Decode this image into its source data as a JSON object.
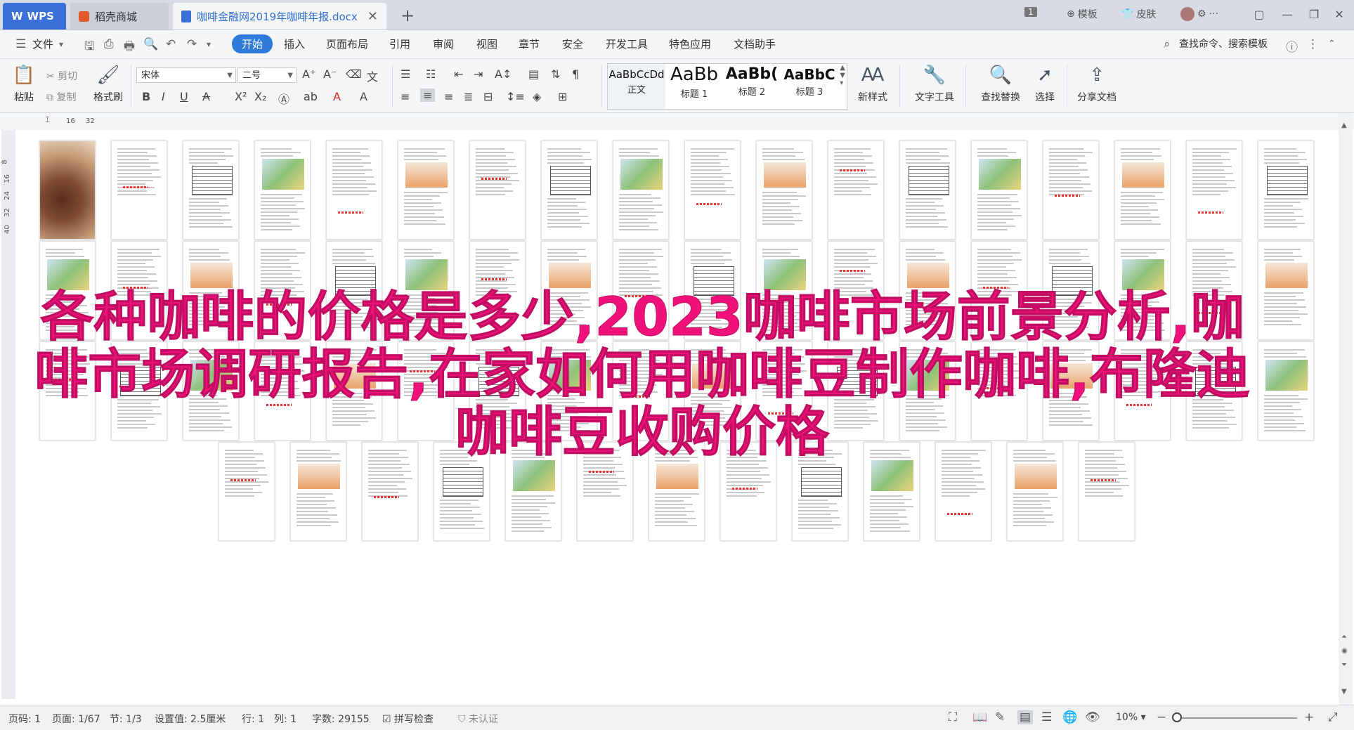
{
  "tabs": {
    "wps_label": "WPS",
    "store_label": "稻壳商城",
    "doc_label": "咖啡金融网2019年咖啡年报.docx",
    "new_tab": "+"
  },
  "titlebar_right": {
    "badge": "1",
    "template": "模板",
    "skin": "皮肤",
    "more": "···"
  },
  "menu": {
    "file": "文件",
    "items": [
      "开始",
      "插入",
      "页面布局",
      "引用",
      "审阅",
      "视图",
      "章节",
      "安全",
      "开发工具",
      "特色应用",
      "文档助手"
    ],
    "search_placeholder": "查找命令、搜索模板"
  },
  "ribbon": {
    "paste": "粘贴",
    "cut": "剪切",
    "copy": "复制",
    "format_painter": "格式刷",
    "font_name": "宋体",
    "font_size": "二号",
    "styles": [
      {
        "sample": "AaBbCcDd",
        "name": "正文"
      },
      {
        "sample": "AaBb",
        "name": "标题 1"
      },
      {
        "sample": "AaBb(",
        "name": "标题 2"
      },
      {
        "sample": "AaBbC",
        "name": "标题 3"
      }
    ],
    "new_style": "新样式",
    "text_tools": "文字工具",
    "find_replace": "查找替换",
    "select": "选择",
    "share_doc": "分享文档"
  },
  "ruler": {
    "h_marks": [
      "16",
      "32"
    ],
    "v_marks": [
      "8",
      "16",
      "24",
      "32",
      "40"
    ]
  },
  "overlay_title": "各种咖啡的价格是多少,2023咖啡市场前景分析,咖啡市场调研报告,在家如何用咖啡豆制作咖啡,布隆迪咖啡豆收购价格",
  "statusbar": {
    "page_num": "页码: 1",
    "page": "页面: 1/67",
    "section": "节: 1/3",
    "setting": "设置值: 2.5厘米",
    "row": "行: 1",
    "col": "列: 1",
    "word_count": "字数: 29155",
    "spell_check": "拼写检查",
    "auth": "未认证",
    "zoom": "10%"
  },
  "thumbnails": {
    "row_counts": [
      18,
      18,
      18,
      13
    ]
  }
}
